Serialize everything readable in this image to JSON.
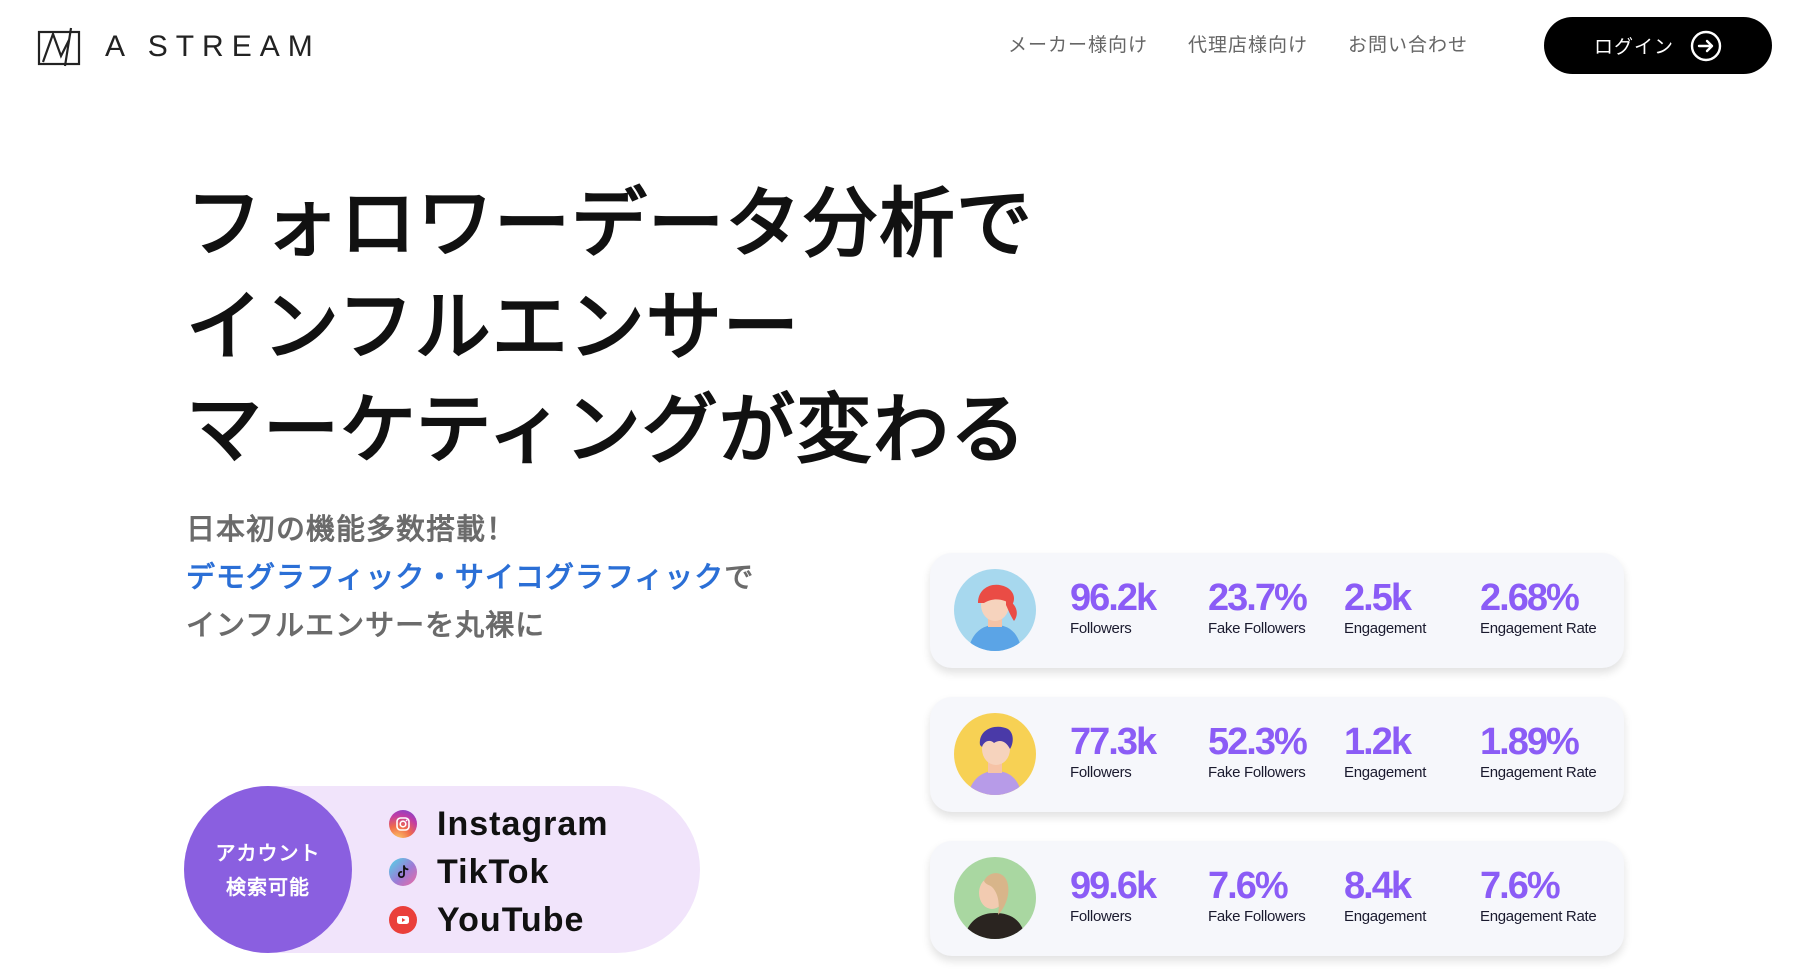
{
  "brand": {
    "name": "A STREAM"
  },
  "nav": [
    {
      "label": "メーカー様向け"
    },
    {
      "label": "代理店様向け"
    },
    {
      "label": "お問い合わせ"
    }
  ],
  "login": {
    "label": "ログイン",
    "icon": "arrow-right-circle-icon"
  },
  "hero": {
    "title_lines": [
      "フォロワーデータ分析で",
      "インフルエンサー",
      "マーケティングが変わる"
    ],
    "sub_line1": "日本初の機能多数搭載！",
    "sub_line2_blue": "デモグラフィック・サイコグラフィック",
    "sub_line2_rest": "で",
    "sub_line3": "インフルエンサーを丸裸に"
  },
  "platforms": {
    "badge_line1": "アカウント",
    "badge_line2": "検索可能",
    "items": [
      {
        "name": "Instagram",
        "icon": "instagram-icon"
      },
      {
        "name": "TikTok",
        "icon": "tiktok-icon"
      },
      {
        "name": "YouTube",
        "icon": "youtube-icon"
      }
    ]
  },
  "cards": [
    {
      "avatar": "avatar-red-hair",
      "stats": [
        {
          "value": "96.2k",
          "label": "Followers"
        },
        {
          "value": "23.7%",
          "label": "Fake Followers"
        },
        {
          "value": "2.5k",
          "label": "Engagement"
        },
        {
          "value": "2.68%",
          "label": "Engagement Rate"
        }
      ]
    },
    {
      "avatar": "avatar-purple-hair",
      "stats": [
        {
          "value": "77.3k",
          "label": "Followers"
        },
        {
          "value": "52.3%",
          "label": "Fake Followers"
        },
        {
          "value": "1.2k",
          "label": "Engagement"
        },
        {
          "value": "1.89%",
          "label": "Engagement Rate"
        }
      ]
    },
    {
      "avatar": "avatar-blonde-hair",
      "stats": [
        {
          "value": "99.6k",
          "label": "Followers"
        },
        {
          "value": "7.6%",
          "label": "Fake Followers"
        },
        {
          "value": "8.4k",
          "label": "Engagement"
        },
        {
          "value": "7.6%",
          "label": "Engagement Rate"
        }
      ]
    }
  ],
  "colors": {
    "accent": "#8b5cf6",
    "badge": "#8a5fe0",
    "pill": "#f1e4fb",
    "blue": "#2b6fd6"
  }
}
